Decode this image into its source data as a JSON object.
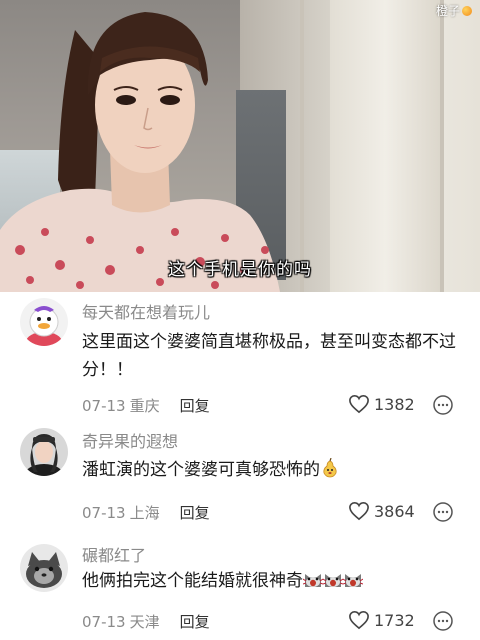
{
  "video": {
    "subtitle": "这个手机是你的吗",
    "watermark": "橙子"
  },
  "comments": [
    {
      "username": "每天都在想着玩儿",
      "text": "这里面这个婆婆简直堪称极品，甚至叫变态都不过分！！",
      "date": "07-13",
      "location": "重庆",
      "reply": "回复",
      "likes": "1382"
    },
    {
      "username": "奇异果的遐想",
      "text": "潘虹演的这个婆婆可真够恐怖的",
      "date": "07-13",
      "location": "上海",
      "reply": "回复",
      "likes": "3864"
    },
    {
      "username": "碾都红了",
      "text": "他俩拍完这个能结婚就很神奇",
      "date": "07-13",
      "location": "天津",
      "reply": "回复",
      "likes": "1732"
    }
  ],
  "icons": {
    "like": "heart-outline-icon",
    "more": "more-dots-icon",
    "emoji_pear": "pear-emoji-icon",
    "emoji_cat": "screaming-cat-emoji-icon"
  },
  "colors": {
    "username": "#8a8a8a",
    "text": "#1a1a1a",
    "meta": "#8a8a8a"
  }
}
